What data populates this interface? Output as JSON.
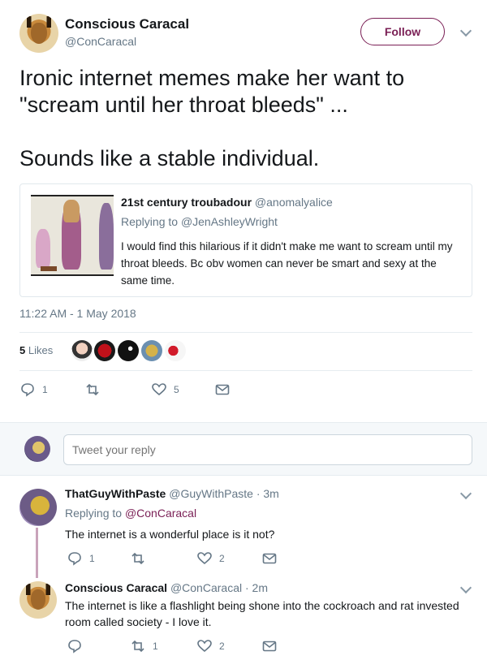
{
  "tweet": {
    "author_name": "Conscious Caracal",
    "author_handle": "@ConCaracal",
    "follow_label": "Follow",
    "text": "Ironic internet memes make her want to \"scream until her throat bleeds\" ...\n\nSounds like a stable individual.",
    "timestamp": "11:22 AM - 1 May 2018",
    "likes_count": "5",
    "likes_label": "Likes",
    "actions": {
      "reply_count": "1",
      "retweet_count": "",
      "like_count": "5"
    }
  },
  "quoted": {
    "author_name": "21st century troubadour",
    "author_handle": "@anomalyalice",
    "replying_prefix": "Replying to",
    "replying_to": "@JenAshleyWright",
    "text": "I would find this hilarious if it didn't make me want to scream until my throat bleeds. Bc obv women can never be smart and sexy at the same time."
  },
  "reply_box": {
    "placeholder": "Tweet your reply"
  },
  "replies": [
    {
      "author_name": "ThatGuyWithPaste",
      "author_handle": "@GuyWithPaste",
      "time": "3m",
      "replying_prefix": "Replying to",
      "replying_to": "@ConCaracal",
      "text": "The internet is a wonderful place is it not?",
      "reply_count": "1",
      "retweet_count": "",
      "like_count": "2"
    },
    {
      "author_name": "Conscious Caracal",
      "author_handle": "@ConCaracal",
      "time": "2m",
      "text": "The internet is like a flashlight being shone into the cockroach and rat invested room called society - I love it.",
      "reply_count": "",
      "retweet_count": "1",
      "like_count": "2"
    }
  ],
  "colors": {
    "accent": "#7a1f55",
    "muted": "#657786",
    "text": "#14171a",
    "border": "#e6ecf0"
  },
  "icons": [
    "reply-icon",
    "retweet-icon",
    "heart-icon",
    "message-icon",
    "chevron-down-icon"
  ]
}
